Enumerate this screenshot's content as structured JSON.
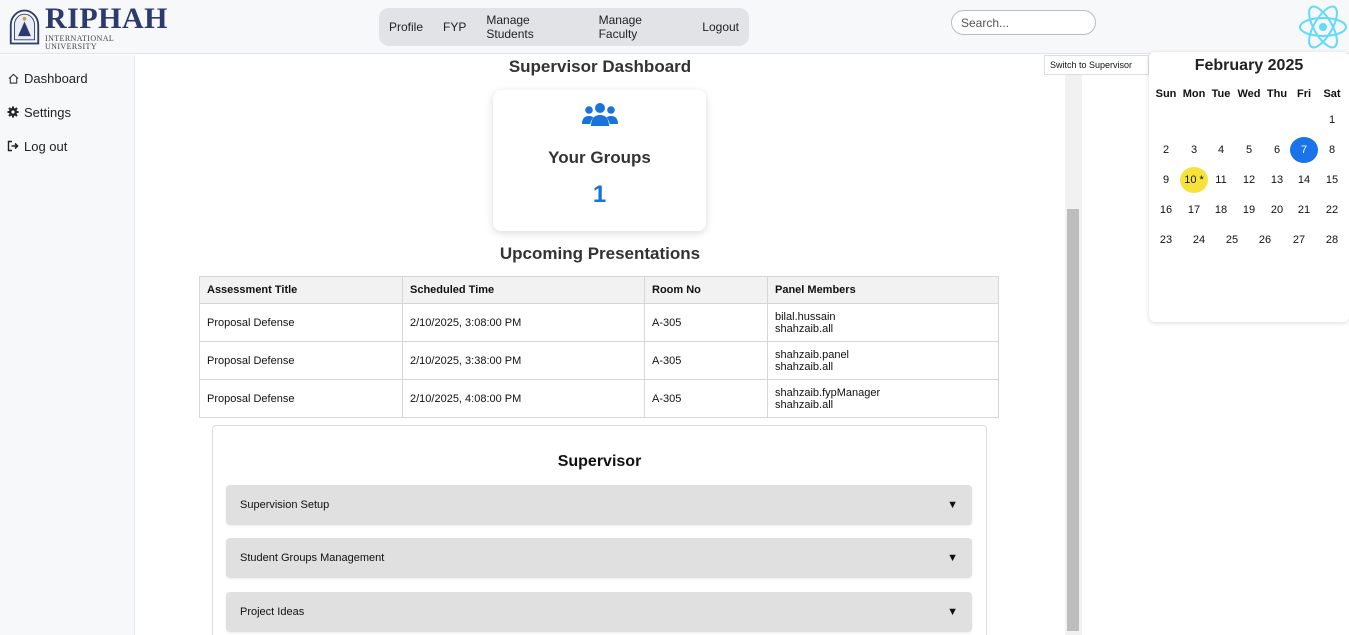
{
  "header": {
    "logo": {
      "name": "RIPHAH",
      "subtitle": "INTERNATIONAL UNIVERSITY"
    },
    "nav": [
      "Profile",
      "FYP",
      "Manage Students",
      "Manage Faculty",
      "Logout"
    ],
    "search": {
      "placeholder": "Search...",
      "value": ""
    }
  },
  "sidebar": {
    "items": [
      {
        "label": "Dashboard",
        "icon": "home-icon"
      },
      {
        "label": "Settings",
        "icon": "gear-icon"
      },
      {
        "label": "Log out",
        "icon": "logout-icon"
      }
    ]
  },
  "main": {
    "title": "Supervisor Dashboard",
    "groups_card": {
      "label": "Your Groups",
      "count": "1",
      "icon": "users-icon",
      "accent": "#1a73d9"
    },
    "upcoming_title": "Upcoming Presentations",
    "table": {
      "headers": [
        "Assessment Title",
        "Scheduled Time",
        "Room No",
        "Panel Members"
      ],
      "rows": [
        {
          "title": "Proposal Defense",
          "time": "2/10/2025, 3:08:00 PM",
          "room": "A-305",
          "panel": [
            "bilal.hussain",
            "shahzaib.all"
          ]
        },
        {
          "title": "Proposal Defense",
          "time": "2/10/2025, 3:38:00 PM",
          "room": "A-305",
          "panel": [
            "shahzaib.panel",
            "shahzaib.all"
          ]
        },
        {
          "title": "Proposal Defense",
          "time": "2/10/2025, 4:08:00 PM",
          "room": "A-305",
          "panel": [
            "shahzaib.fypManager",
            "shahzaib.all"
          ]
        }
      ]
    },
    "supervisor_panel": {
      "title": "Supervisor",
      "sections": [
        {
          "label": "Supervision Setup",
          "arrow": "▼"
        },
        {
          "label": "Student Groups Management",
          "arrow": "▼"
        },
        {
          "label": "Project Ideas",
          "arrow": "▼"
        }
      ]
    }
  },
  "switch_button": "Switch to Supervisor",
  "calendar": {
    "title": "February 2025",
    "days_of_week": [
      "Sun",
      "Mon",
      "Tue",
      "Wed",
      "Thu",
      "Fri",
      "Sat"
    ],
    "weeks": [
      [
        "",
        "",
        "",
        "",
        "",
        "",
        "1"
      ],
      [
        "2",
        "3",
        "4",
        "5",
        "6",
        "7",
        "8"
      ],
      [
        "9",
        "10 *",
        "11",
        "12",
        "13",
        "14",
        "15"
      ],
      [
        "16",
        "17",
        "18",
        "19",
        "20",
        "21",
        "22"
      ],
      [
        "23",
        "24",
        "25",
        "26",
        "27",
        "28",
        ""
      ]
    ],
    "today": "7",
    "event_day": "10 *",
    "today_color": "#1a73e8",
    "event_color": "#f7e23b"
  }
}
